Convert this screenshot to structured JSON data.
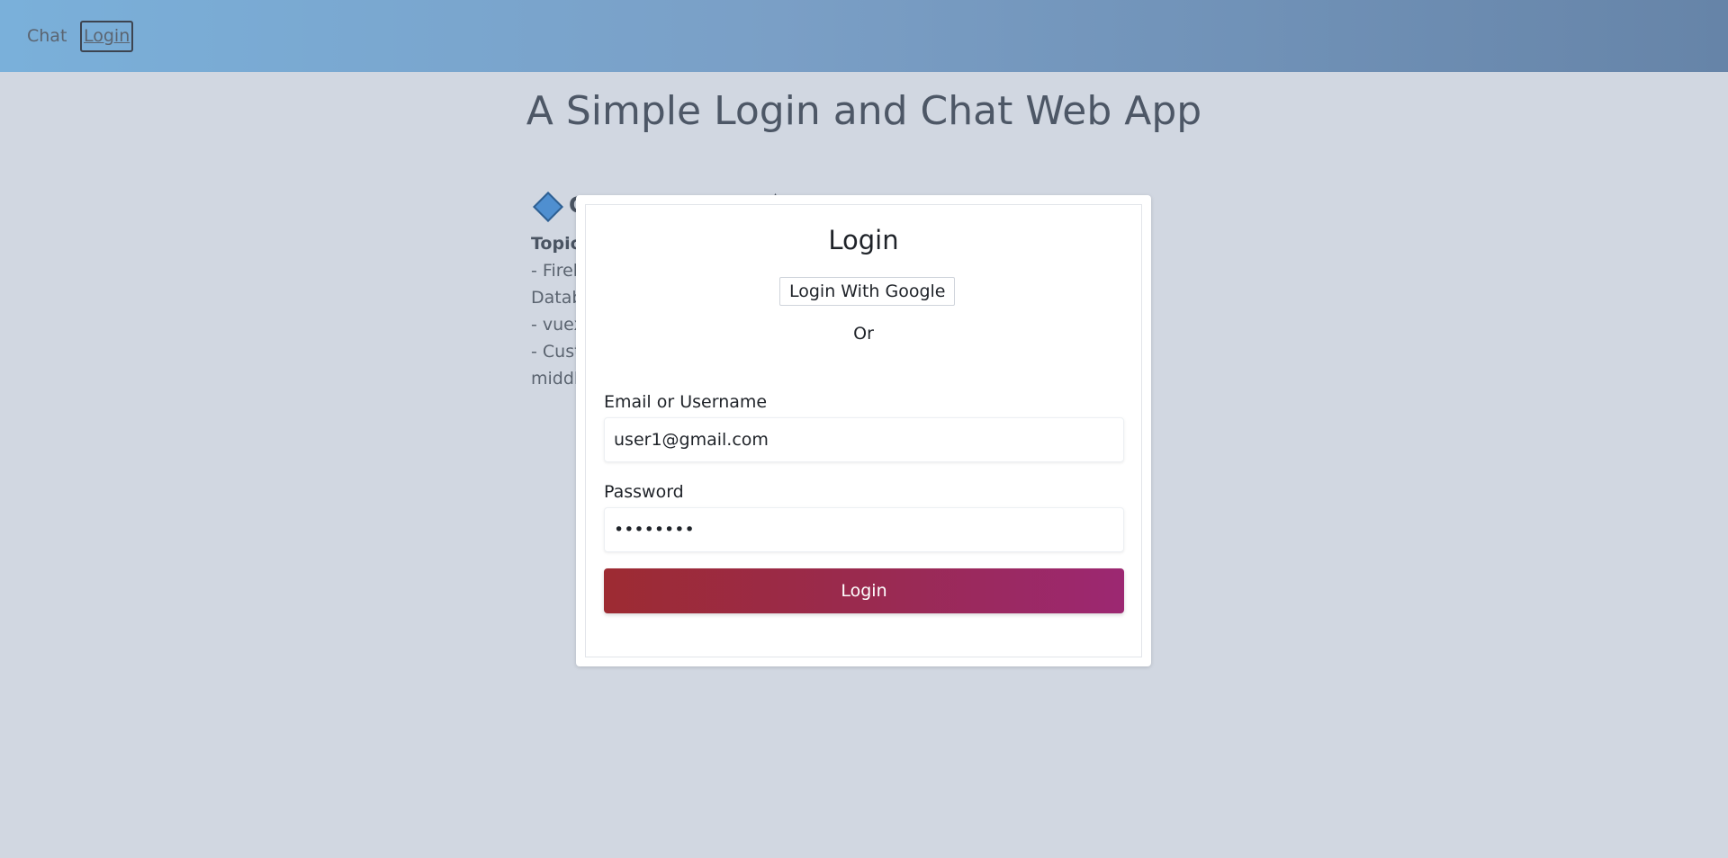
{
  "nav": {
    "chat_label": "Chat",
    "login_label": "Login"
  },
  "page": {
    "title": "A Simple Login and Chat Web App"
  },
  "background_content": {
    "heading_partial": "C",
    "topics_label": "Topic",
    "lines": [
      "- Fireb",
      "Datab",
      "- vuex",
      "- Cust",
      "middl"
    ]
  },
  "login_modal": {
    "title": "Login",
    "google_button_label": "Login With Google",
    "or_text": "Or",
    "email_label": "Email or Username",
    "email_value": "user1@gmail.com",
    "password_label": "Password",
    "password_value": "password",
    "submit_label": "Login"
  },
  "colors": {
    "accent_gradient_start": "#9d2b32",
    "accent_gradient_end": "#9c2872",
    "header_gradient_start": "#7ab0da",
    "header_gradient_end": "#6684a8",
    "page_background": "#d1d7e1"
  }
}
